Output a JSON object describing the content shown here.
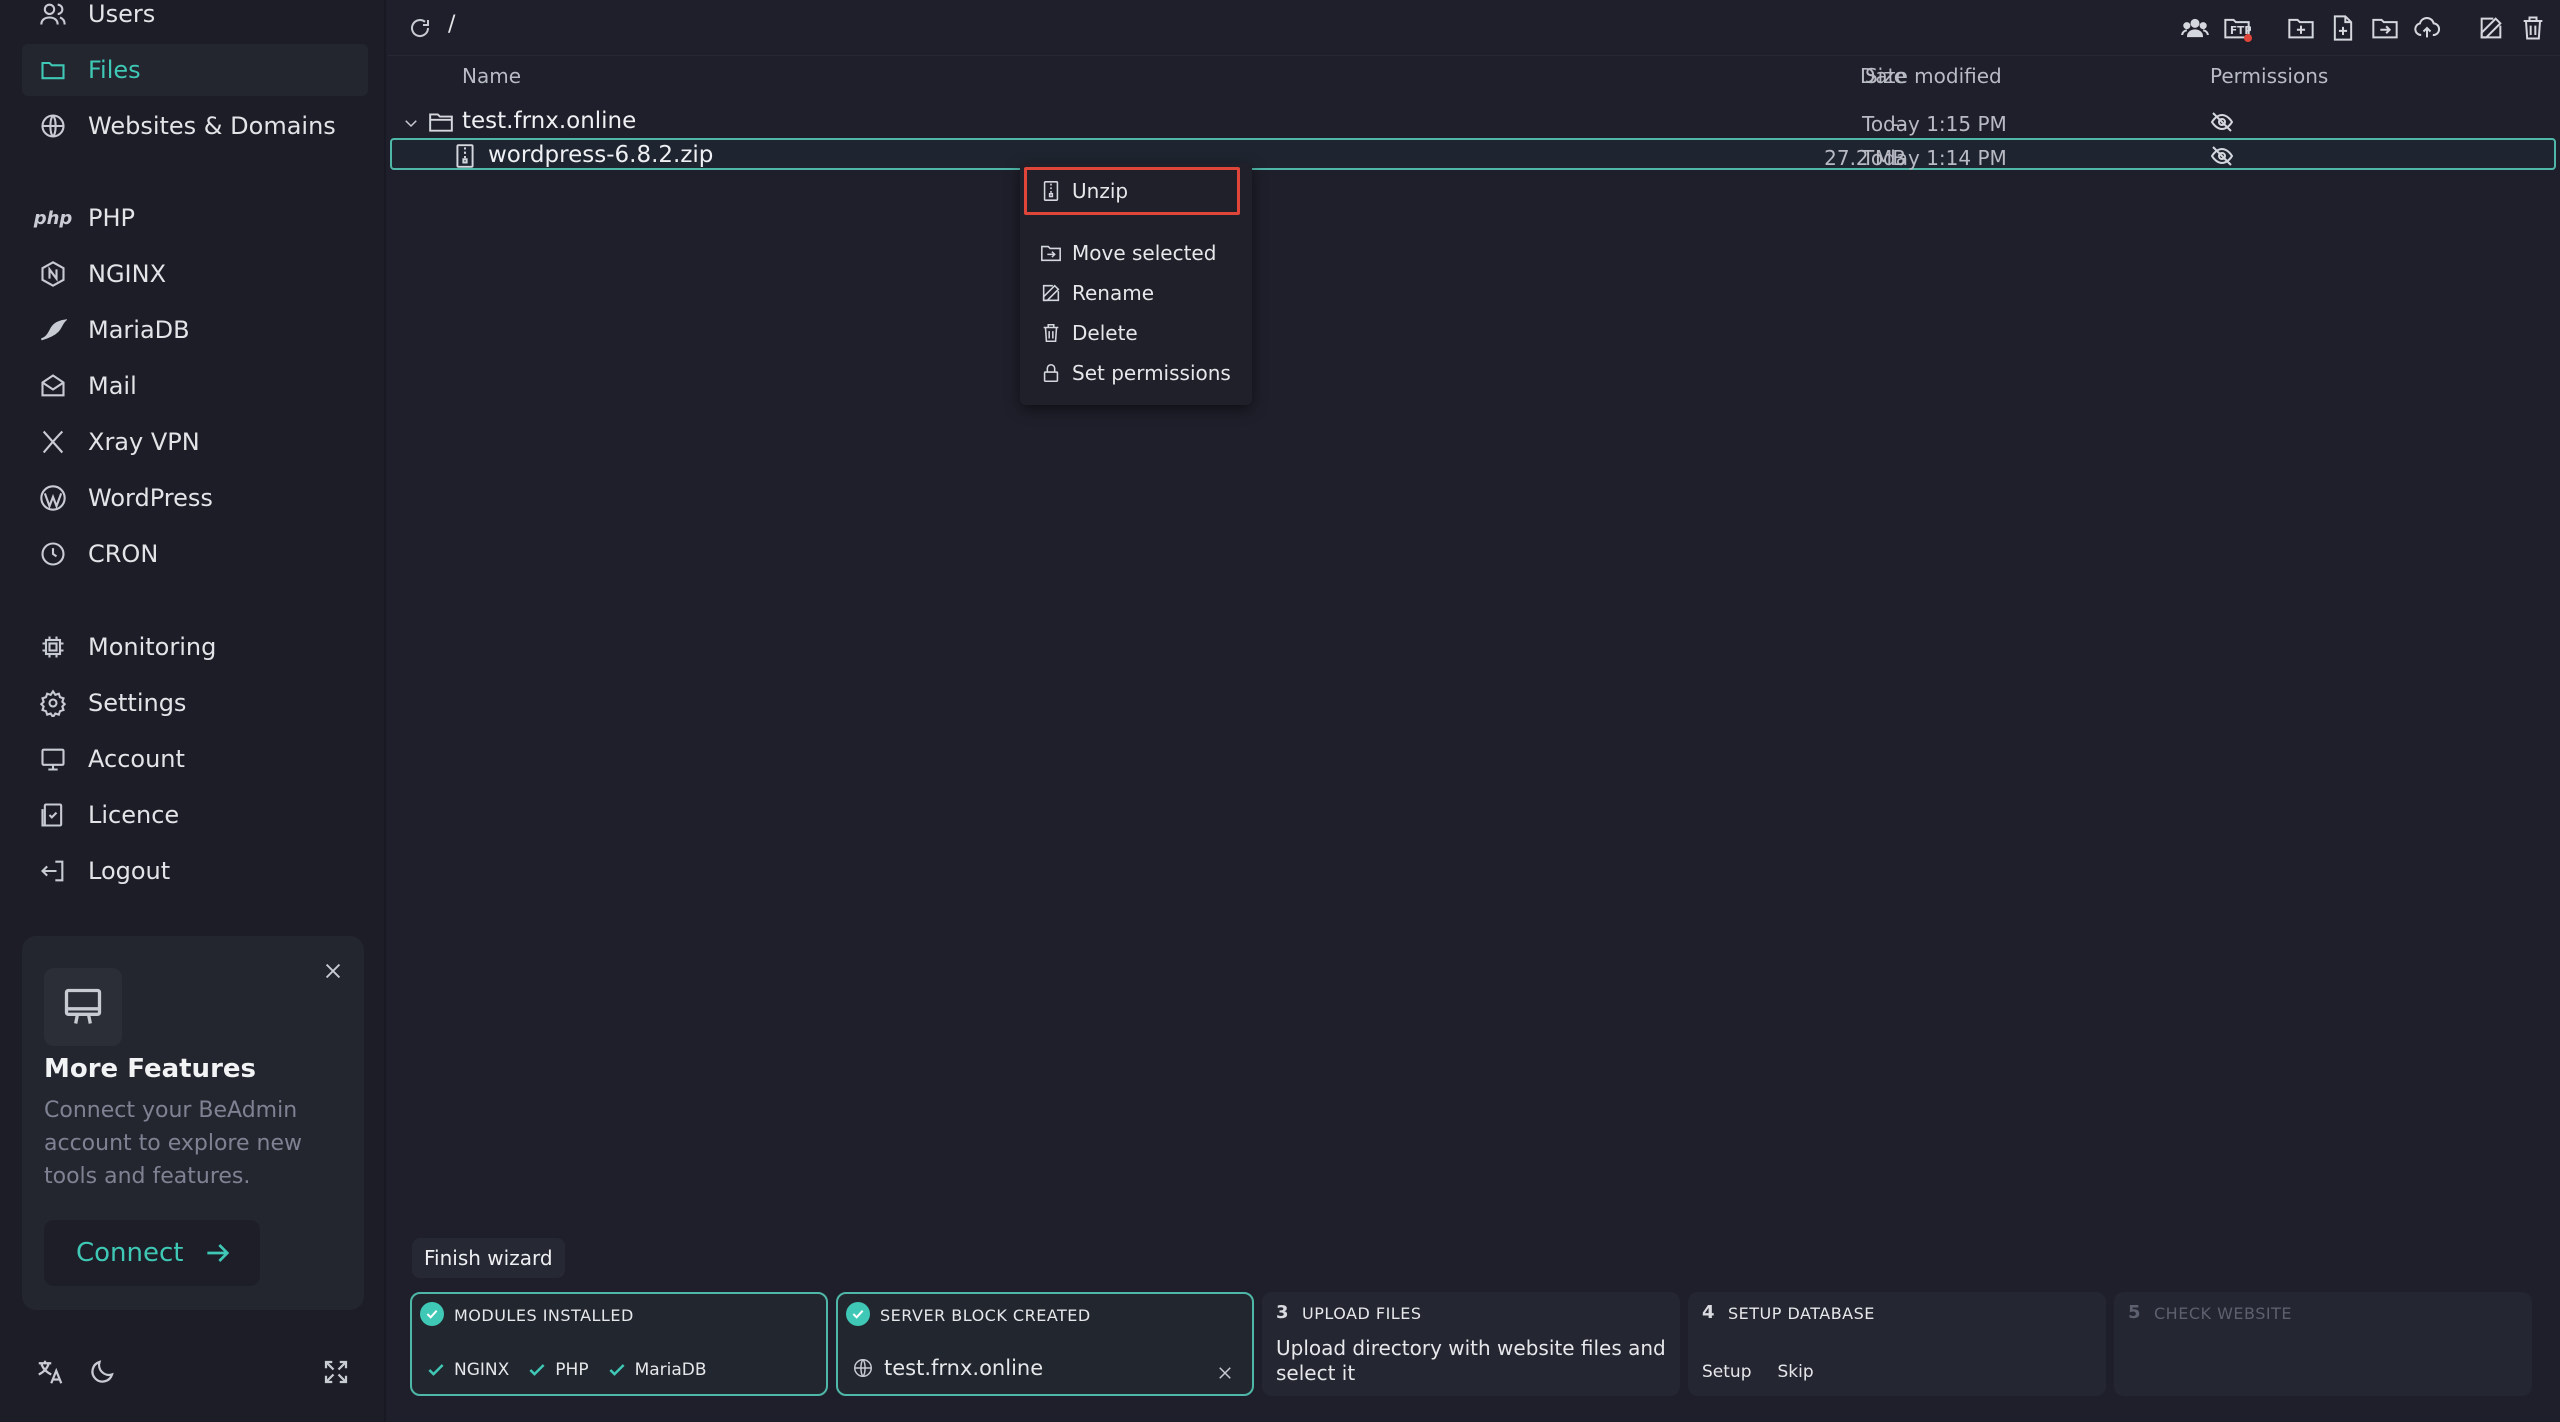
{
  "sidebar": {
    "nav": [
      {
        "label": "Users",
        "icon": "users-icon"
      },
      {
        "label": "Files",
        "icon": "folder-icon"
      },
      {
        "label": "Websites & Domains",
        "icon": "globe-icon"
      },
      {
        "label": "PHP",
        "icon": "php-icon"
      },
      {
        "label": "NGINX",
        "icon": "nginx-icon"
      },
      {
        "label": "MariaDB",
        "icon": "mariadb-icon"
      },
      {
        "label": "Mail",
        "icon": "mail-icon"
      },
      {
        "label": "Xray VPN",
        "icon": "xray-icon"
      },
      {
        "label": "WordPress",
        "icon": "wordpress-icon"
      },
      {
        "label": "CRON",
        "icon": "clock-icon"
      },
      {
        "label": "Monitoring",
        "icon": "cpu-icon"
      },
      {
        "label": "Settings",
        "icon": "gear-icon"
      },
      {
        "label": "Account",
        "icon": "monitor-icon"
      },
      {
        "label": "Licence",
        "icon": "license-icon"
      },
      {
        "label": "Logout",
        "icon": "logout-icon"
      }
    ],
    "active": "Files",
    "php_logo_text": "php",
    "promo": {
      "title": "More Features",
      "description": "Connect your BeAdmin account to explore new tools and features.",
      "button": "Connect"
    }
  },
  "topbar": {
    "path": "/"
  },
  "table": {
    "columns": {
      "name": "Name",
      "size": "Size",
      "date": "Date modified",
      "permissions": "Permissions"
    },
    "rows": [
      {
        "name": "test.frnx.online",
        "type": "folder",
        "size": "--",
        "date": "Today 1:15 PM"
      },
      {
        "name": "wordpress-6.8.2.zip",
        "type": "zip",
        "size": "27.2 MB",
        "date": "Today 1:14 PM"
      }
    ]
  },
  "context_menu": {
    "items": [
      "Unzip",
      "Move selected",
      "Rename",
      "Delete",
      "Set permissions"
    ],
    "highlighted": "Unzip"
  },
  "wizard": {
    "finish_label": "Finish wizard",
    "steps": [
      {
        "title": "MODULES INSTALLED",
        "status": "done",
        "tags": [
          "NGINX",
          "PHP",
          "MariaDB"
        ]
      },
      {
        "title": "SERVER BLOCK CREATED",
        "status": "done",
        "domain": "test.frnx.online"
      },
      {
        "number": "3",
        "title": "UPLOAD FILES",
        "status": "active",
        "body": "Upload directory with website files and select it"
      },
      {
        "number": "4",
        "title": "SETUP DATABASE",
        "status": "pending",
        "buttons": [
          "Setup",
          "Skip"
        ]
      },
      {
        "number": "5",
        "title": "CHECK WEBSITE",
        "status": "disabled"
      }
    ]
  },
  "colors": {
    "accent": "#3fc8b5",
    "highlight_border": "#e0453a",
    "background": "#1e1f2a"
  }
}
